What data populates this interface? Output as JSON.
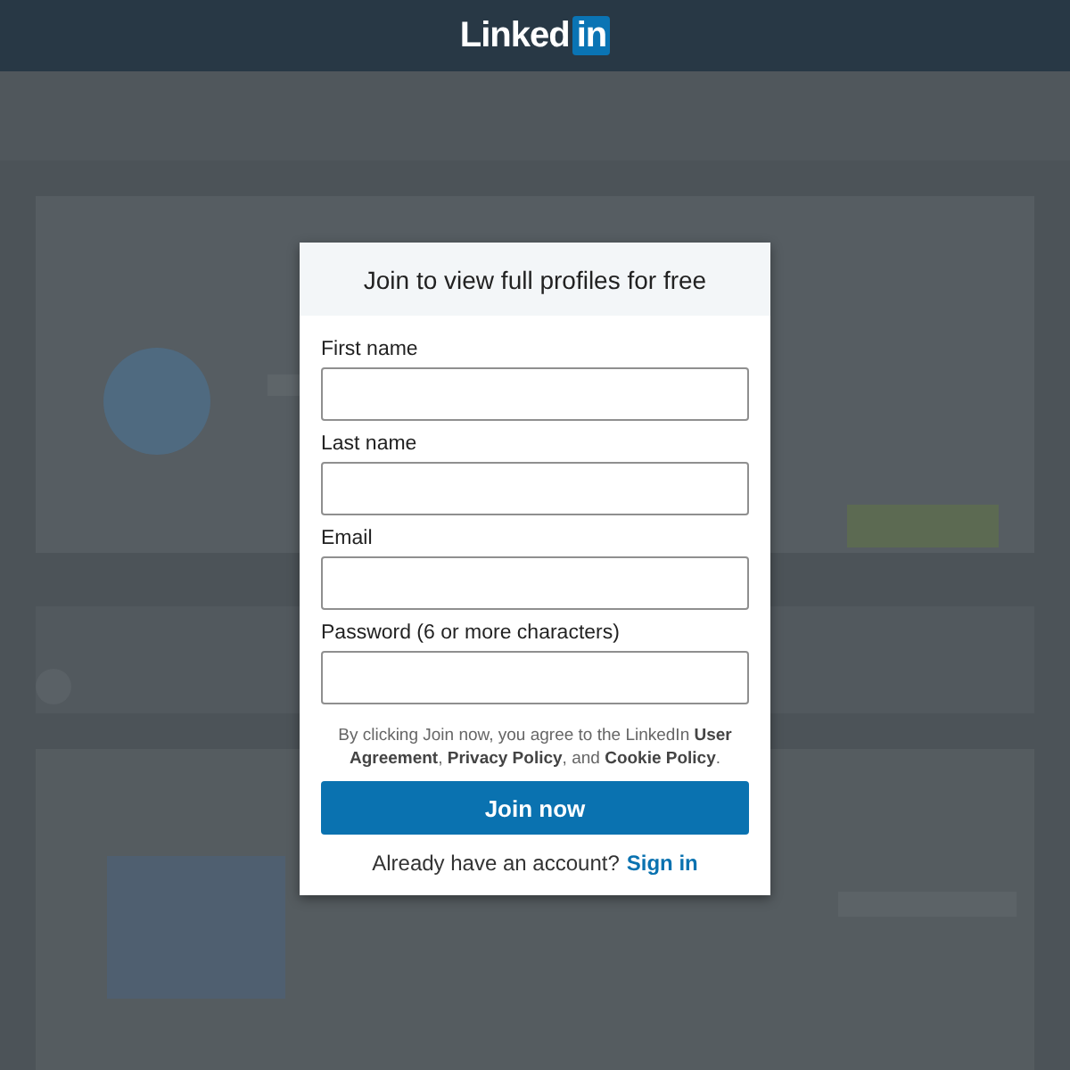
{
  "header": {
    "logo_text": "Linked",
    "logo_badge": "in"
  },
  "dialog": {
    "title": "Join to view full profiles for free",
    "fields": [
      {
        "label": "First name"
      },
      {
        "label": "Last name"
      },
      {
        "label": "Email"
      },
      {
        "label": "Password (6 or more characters)"
      }
    ],
    "legal": "By clicking Join now, you agree to the LinkedIn **User Agreement**, **Privacy Policy**, and **Cookie Policy**.",
    "submit": "Join now",
    "signin_prompt": "Already have an account?",
    "signin_link": "Sign in"
  }
}
